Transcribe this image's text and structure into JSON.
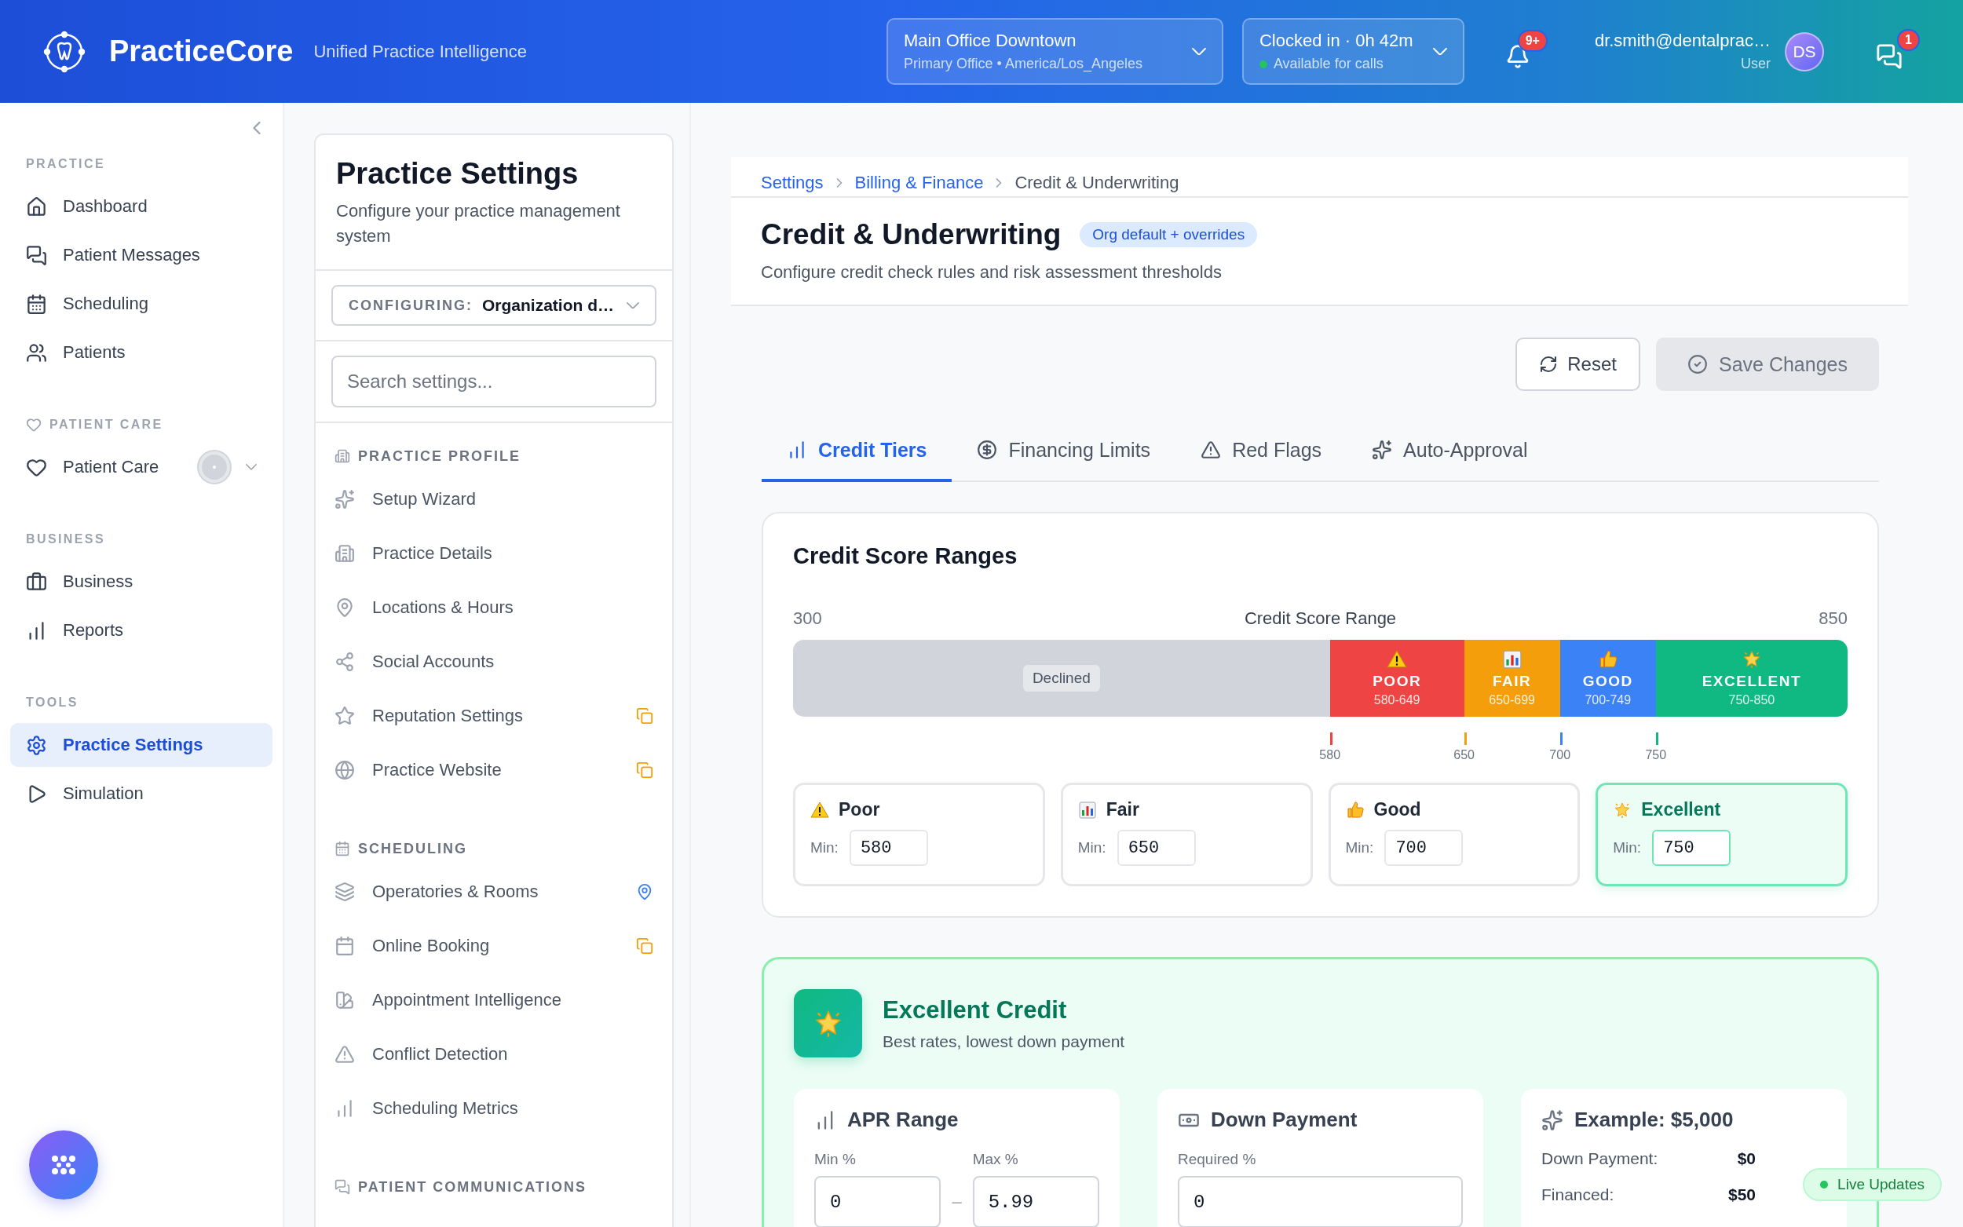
{
  "header": {
    "brand": "PracticeCore",
    "tagline": "Unified Practice Intelligence",
    "location": {
      "name": "Main Office Downtown",
      "detail": "Primary Office • America/Los_Angeles"
    },
    "clock": {
      "status": "Clocked in · 0h 42m",
      "availability": "Available for calls"
    },
    "notifications": {
      "count": "9+"
    },
    "user": {
      "email": "dr.smith@dentalprac…",
      "role": "User",
      "initials": "DS"
    },
    "messages": {
      "count": "1"
    }
  },
  "sidebar": {
    "sections": [
      {
        "label": "PRACTICE",
        "kind": "plain",
        "items": [
          {
            "label": "Dashboard",
            "selected": false,
            "kind": "plain"
          },
          {
            "label": "Patient Messages",
            "selected": false,
            "kind": "plain"
          },
          {
            "label": "Scheduling",
            "selected": false,
            "kind": "plain"
          },
          {
            "label": "Patients",
            "selected": false,
            "kind": "plain"
          }
        ]
      },
      {
        "label": "PATIENT CARE",
        "kind": "icon",
        "items": [
          {
            "label": "Patient Care",
            "selected": false,
            "kind": "expandable"
          }
        ]
      },
      {
        "label": "BUSINESS",
        "kind": "plain",
        "items": [
          {
            "label": "Business",
            "selected": false,
            "kind": "plain"
          },
          {
            "label": "Reports",
            "selected": false,
            "kind": "plain"
          }
        ]
      },
      {
        "label": "TOOLS",
        "kind": "plain",
        "items": [
          {
            "label": "Practice Settings",
            "selected": true,
            "kind": "plain"
          },
          {
            "label": "Simulation",
            "selected": false,
            "kind": "plain"
          }
        ]
      }
    ]
  },
  "settings_panel": {
    "title": "Practice Settings",
    "subtitle": "Configure your practice management system",
    "configuring": {
      "label": "CONFIGURING:",
      "value": "Organization d…"
    },
    "search": {
      "placeholder": "Search settings..."
    },
    "groups": [
      {
        "label": "PRACTICE PROFILE",
        "items": [
          {
            "label": "Setup Wizard",
            "kind": "plain"
          },
          {
            "label": "Practice Details",
            "kind": "plain"
          },
          {
            "label": "Locations & Hours",
            "kind": "plain"
          },
          {
            "label": "Social Accounts",
            "kind": "plain"
          },
          {
            "label": "Reputation Settings",
            "kind": "override"
          },
          {
            "label": "Practice Website",
            "kind": "override"
          }
        ]
      },
      {
        "label": "SCHEDULING",
        "items": [
          {
            "label": "Operatories & Rooms",
            "kind": "location"
          },
          {
            "label": "Online Booking",
            "kind": "override"
          },
          {
            "label": "Appointment Intelligence",
            "kind": "plain"
          },
          {
            "label": "Conflict Detection",
            "kind": "plain"
          },
          {
            "label": "Scheduling Metrics",
            "kind": "plain"
          }
        ]
      },
      {
        "label": "PATIENT COMMUNICATIONS"
      }
    ]
  },
  "main": {
    "breadcrumb": [
      "Settings",
      "Billing & Finance",
      "Credit & Underwriting"
    ],
    "title": "Credit & Underwriting",
    "badge": "Org default + overrides",
    "subtitle": "Configure credit check rules and risk assessment thresholds",
    "reset": {
      "label": "Reset"
    },
    "save": {
      "label": "Save Changes",
      "disabled": true
    },
    "tabs": [
      {
        "label": "Credit Tiers",
        "selected": true
      },
      {
        "label": "Financing Limits",
        "selected": false
      },
      {
        "label": "Red Flags",
        "selected": false
      },
      {
        "label": "Auto-Approval",
        "selected": false
      }
    ],
    "ranges": {
      "title": "Credit Score Ranges",
      "scale_min": "300",
      "scale_label": "Credit Score Range",
      "scale_max": "850",
      "declined": "Declined",
      "tiers": [
        {
          "name": "POOR",
          "range": "580-649",
          "tick": "580",
          "color": "#ef4444",
          "card_name": "Poor",
          "min_label": "Min:",
          "min": "580",
          "selected": false
        },
        {
          "name": "FAIR",
          "range": "650-699",
          "tick": "650",
          "color": "#f59e0b",
          "card_name": "Fair",
          "min_label": "Min:",
          "min": "650",
          "selected": false
        },
        {
          "name": "GOOD",
          "range": "700-749",
          "tick": "700",
          "color": "#3b82f6",
          "card_name": "Good",
          "min_label": "Min:",
          "min": "700",
          "selected": false
        },
        {
          "name": "EXCELLENT",
          "range": "750-850",
          "tick": "750",
          "color": "#10b981",
          "card_name": "Excellent",
          "min_label": "Min:",
          "min": "750",
          "selected": true
        }
      ]
    },
    "detail": {
      "title": "Excellent Credit",
      "subtitle": "Best rates, lowest down payment",
      "apr": {
        "title": "APR Range",
        "min_label": "Min %",
        "min": "0",
        "separator": "–",
        "max_label": "Max %",
        "max": "5.99"
      },
      "down": {
        "title": "Down Payment",
        "label": "Required %",
        "value": "0"
      },
      "example": {
        "title": "Example: $5,000",
        "rows": [
          {
            "label": "Down Payment:",
            "value": "$0"
          },
          {
            "label": "Financed:",
            "value": "$50"
          }
        ]
      }
    },
    "live": "Live Updates"
  }
}
